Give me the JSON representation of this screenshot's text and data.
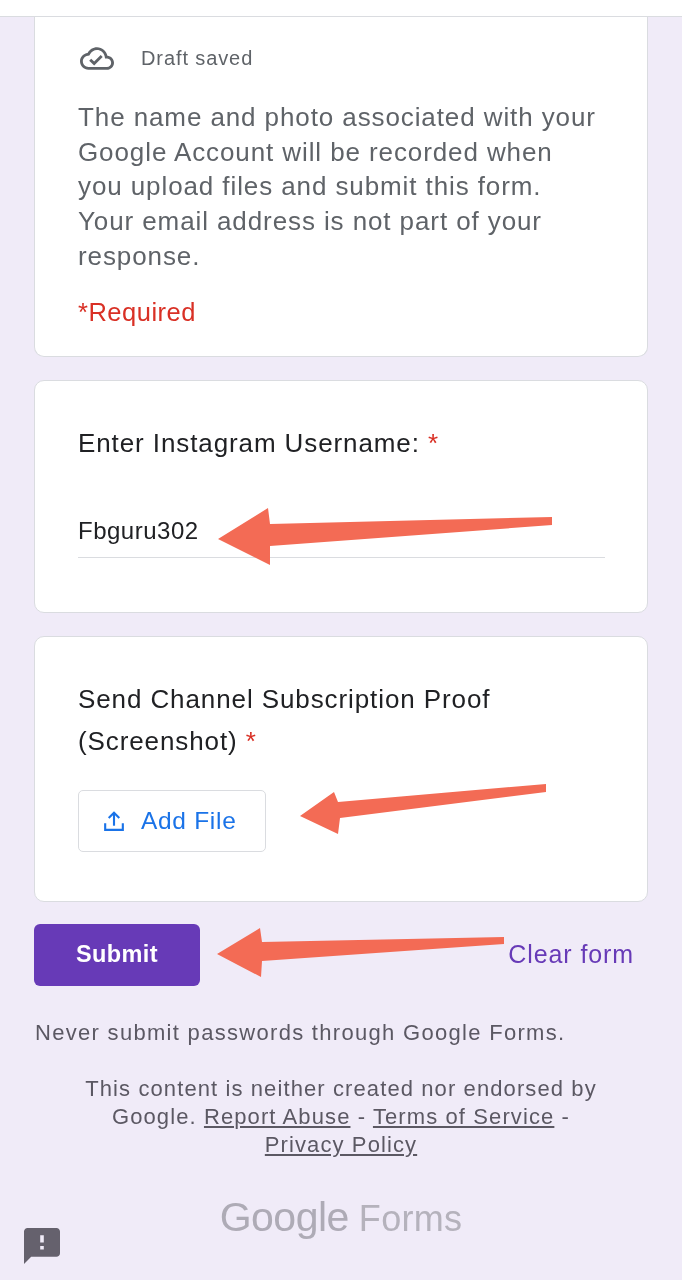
{
  "intro_card": {
    "draft_status": "Draft saved",
    "notice": "The name and photo associated with your Google Account will be recorded when you upload files and submit this form. Your email address is not part of your response.",
    "required_note": "*Required"
  },
  "questions": [
    {
      "kind": "short_answer",
      "title": "Enter Instagram Username:",
      "required_mark": "*",
      "value": "Fbguru302"
    },
    {
      "kind": "file_upload",
      "title": "Send Channel Subscription Proof (Screenshot)",
      "required_mark": "*",
      "button": "Add File"
    }
  ],
  "actions": {
    "submit": "Submit",
    "clear": "Clear form"
  },
  "footer": {
    "warning": "Never submit passwords through Google Forms.",
    "disclaimer": "This content is neither created nor endorsed by Google.",
    "links": [
      "Report Abuse",
      "Terms of Service",
      "Privacy Policy"
    ],
    "separator": "-"
  },
  "logo": {
    "brand": "Google",
    "product": "Forms"
  }
}
